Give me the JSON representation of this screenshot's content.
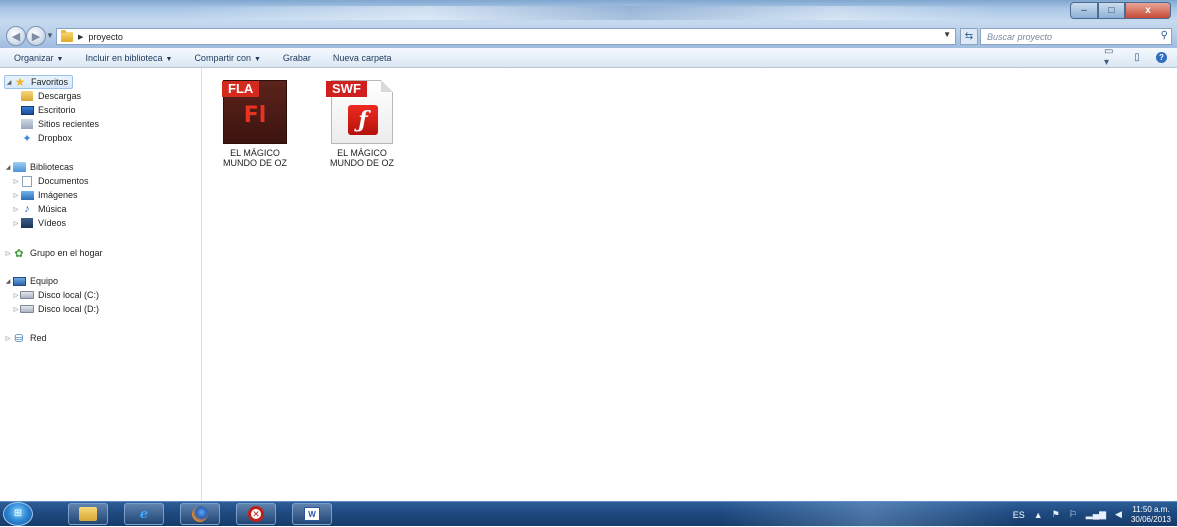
{
  "window": {
    "breadcrumb": "proyecto",
    "search_placeholder": "Buscar proyecto",
    "controls": {
      "minimize": "–",
      "maximize": "□",
      "close": "x"
    }
  },
  "toolbar": {
    "items": [
      {
        "label": "Organizar",
        "has_dropdown": true
      },
      {
        "label": "Incluir en biblioteca",
        "has_dropdown": true
      },
      {
        "label": "Compartir con",
        "has_dropdown": true
      },
      {
        "label": "Grabar",
        "has_dropdown": false
      },
      {
        "label": "Nueva carpeta",
        "has_dropdown": false
      }
    ],
    "right_icons": [
      "view-options-icon",
      "preview-pane-icon",
      "help-icon"
    ]
  },
  "navpane": {
    "favorites": {
      "label": "Favoritos",
      "icon": "star-icon",
      "items": [
        {
          "label": "Descargas",
          "icon": "downloads-folder-icon"
        },
        {
          "label": "Escritorio",
          "icon": "desktop-icon"
        },
        {
          "label": "Sitios recientes",
          "icon": "recent-places-icon"
        },
        {
          "label": "Dropbox",
          "icon": "dropbox-icon"
        }
      ]
    },
    "libraries": {
      "label": "Bibliotecas",
      "icon": "libraries-icon",
      "items": [
        {
          "label": "Documentos",
          "icon": "documents-icon"
        },
        {
          "label": "Imágenes",
          "icon": "pictures-icon"
        },
        {
          "label": "Música",
          "icon": "music-icon"
        },
        {
          "label": "Vídeos",
          "icon": "videos-icon"
        }
      ]
    },
    "homegroup": {
      "label": "Grupo en el hogar",
      "icon": "homegroup-icon"
    },
    "computer": {
      "label": "Equipo",
      "icon": "computer-icon",
      "items": [
        {
          "label": "Disco local (C:)",
          "icon": "local-disk-icon"
        },
        {
          "label": "Disco local (D:)",
          "icon": "local-disk-icon"
        }
      ]
    },
    "network": {
      "label": "Red",
      "icon": "network-icon"
    }
  },
  "files": [
    {
      "name": "EL MÁGICO\nMUNDO DE OZ",
      "type_tag": "FLA",
      "glyph": "Fl",
      "icon": "flash-fla-file-icon"
    },
    {
      "name": "EL MÁGICO\nMUNDO DE OZ",
      "type_tag": "SWF",
      "glyph": "ƒ",
      "icon": "flash-swf-file-icon"
    }
  ],
  "taskbar": {
    "pinned": [
      "start-orb-icon",
      "windows-explorer-icon",
      "internet-explorer-icon",
      "firefox-icon",
      "blocked-app-icon",
      "word-icon"
    ],
    "tray": {
      "language": "ES",
      "time": "11:50 a.m.",
      "date": "30/06/2013"
    }
  },
  "colors": {
    "accent": "#2f6fc0",
    "fla_red": "#d42a1e",
    "swf_red": "#cf1f1f",
    "taskbar": "#1f4a80"
  }
}
